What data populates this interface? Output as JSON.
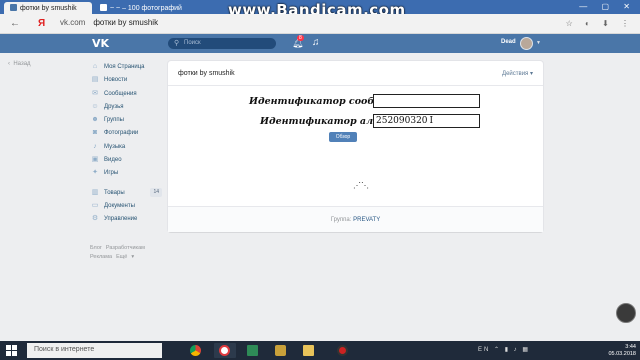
{
  "browser": {
    "tabs": [
      {
        "title": "фотки by smushik",
        "active": true
      },
      {
        "title": "~ ~ – 100 фотографий",
        "active": false
      }
    ],
    "overlay_watermark": "www.Bandicam.com",
    "nav": {
      "back": "←",
      "yandex": "Я"
    },
    "url_domain": "vk.com",
    "url_page_title": "фотки by smushik"
  },
  "vk_header": {
    "logo": "VK",
    "search_placeholder": "Поиск",
    "notification_count": "8",
    "username": "Dead"
  },
  "back_link": "Назад",
  "left_menu": {
    "items": [
      {
        "label": "Моя Страница",
        "icon": "home-icon"
      },
      {
        "label": "Новости",
        "icon": "news-icon"
      },
      {
        "label": "Сообщения",
        "icon": "messages-icon"
      },
      {
        "label": "Друзья",
        "icon": "friends-icon"
      },
      {
        "label": "Группы",
        "icon": "groups-icon"
      },
      {
        "label": "Фотографии",
        "icon": "photos-icon"
      },
      {
        "label": "Музыка",
        "icon": "music-icon"
      },
      {
        "label": "Видео",
        "icon": "video-icon"
      },
      {
        "label": "Игры",
        "icon": "games-icon"
      }
    ],
    "items2": [
      {
        "label": "Товары",
        "icon": "goods-icon",
        "count": "14"
      },
      {
        "label": "Документы",
        "icon": "documents-icon"
      },
      {
        "label": "Управление",
        "icon": "manage-icon"
      }
    ],
    "footer": [
      "Блог",
      "Разработчикам",
      "Реклама",
      "Ещё"
    ]
  },
  "app_card": {
    "title": "фотки by smushik",
    "actions_label": "Действия",
    "community_label": "Идентификатор сообщества:",
    "community_value": "",
    "album_label": "Идентификатор альбома:",
    "album_value": "252090320",
    "browse_button": "Обзор",
    "loader": "⋰⋱",
    "footer_prefix": "Группа:",
    "footer_group": "PREVATY"
  },
  "taskbar": {
    "search_placeholder": "Поиск в интернете",
    "language": "EN",
    "time": "3:44",
    "date": "05.03.2018"
  }
}
